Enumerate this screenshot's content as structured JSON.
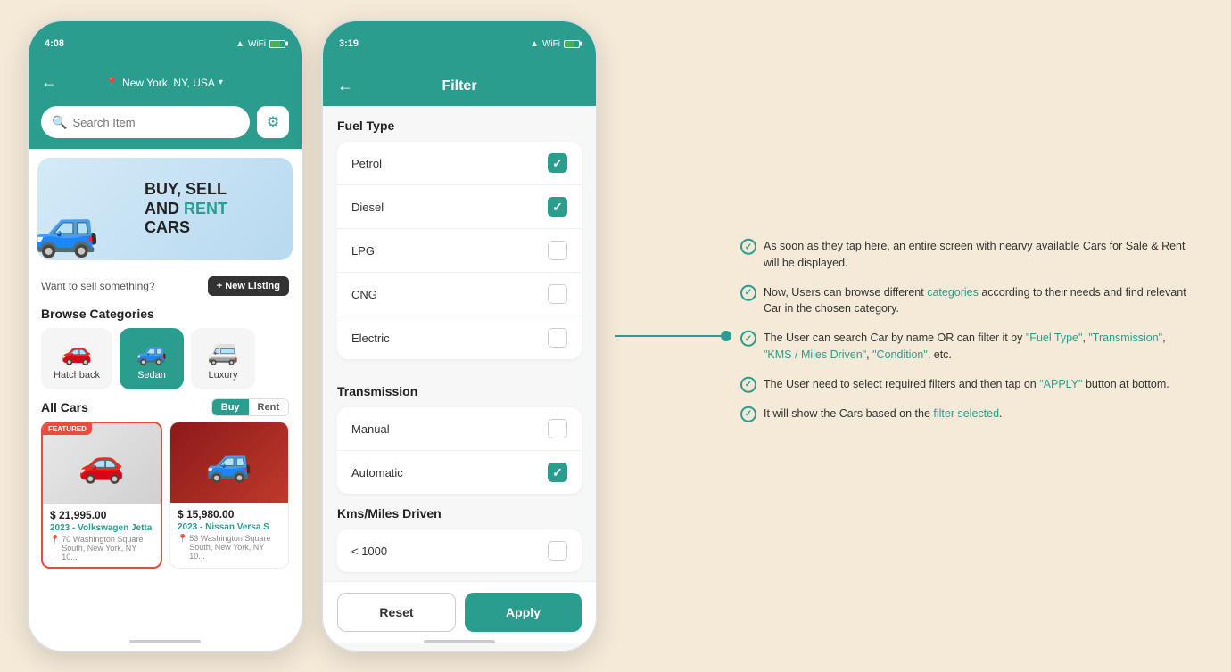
{
  "phone1": {
    "status_time": "4:08",
    "location": "New York, NY, USA",
    "search_placeholder": "Search Item",
    "banner": {
      "line1": "BUY, SELL",
      "line2": "AND",
      "line3_highlight": "RENT",
      "line4": "CARS"
    },
    "sell_text": "Want to sell something?",
    "new_listing_label": "+ New Listing",
    "browse_title": "Browse Categories",
    "categories": [
      {
        "icon": "🚗",
        "label": "Hatchback",
        "active": false
      },
      {
        "icon": "🚙",
        "label": "Sedan",
        "active": true
      },
      {
        "icon": "🚐",
        "label": "Luxury",
        "active": false
      }
    ],
    "all_cars_title": "All Cars",
    "toggle_buy": "Buy",
    "toggle_rent": "Rent",
    "cars": [
      {
        "featured": true,
        "featured_label": "FEATURED",
        "price": "$ 21,995.00",
        "name": "2023 - Volkswagen Jetta",
        "location": "70 Washington Square South, New York, NY 10..."
      },
      {
        "featured": false,
        "price": "$ 15,980.00",
        "name": "2023 - Nissan Versa S",
        "location": "53 Washington Square South, New York, NY 10..."
      }
    ]
  },
  "phone2": {
    "status_time": "3:19",
    "header_title": "Filter",
    "fuel_type_title": "Fuel Type",
    "fuel_types": [
      {
        "label": "Petrol",
        "checked": true
      },
      {
        "label": "Diesel",
        "checked": true
      },
      {
        "label": "LPG",
        "checked": false
      },
      {
        "label": "CNG",
        "checked": false
      },
      {
        "label": "Electric",
        "checked": false
      }
    ],
    "transmission_title": "Transmission",
    "transmissions": [
      {
        "label": "Manual",
        "checked": false
      },
      {
        "label": "Automatic",
        "checked": true
      }
    ],
    "kms_title": "Kms/Miles Driven",
    "kms_options": [
      {
        "label": "< 1000",
        "checked": false
      }
    ],
    "reset_label": "Reset",
    "apply_label": "Apply"
  },
  "annotations": [
    {
      "text": "As soon as they tap here, an entire screen with nearvy available Cars for Sale & Rent will be displayed.",
      "highlight_words": []
    },
    {
      "text": "Now, Users can browse different categories according to their needs and find relevant Car in the chosen category.",
      "highlight": "categories"
    },
    {
      "text": "The User can search Car by name OR can filter it by \"Fuel Type\", \"Transmission\", \"KMS / Miles Driven\", \"Condition\", etc.",
      "highlight": "filter"
    },
    {
      "text": "The User need to select required filters and then tap on \"APPLY\" button at bottom.",
      "highlight": "APPLY"
    },
    {
      "text": "It will show the Cars based on the filter selected.",
      "highlight": "filter selected"
    }
  ]
}
